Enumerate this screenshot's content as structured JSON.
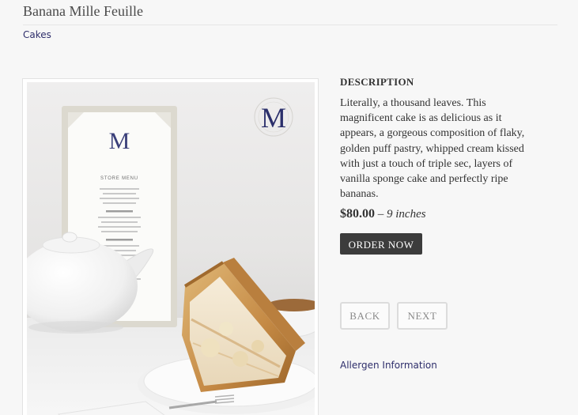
{
  "product": {
    "title": "Banana Mille Feuille",
    "category": "Cakes",
    "description_heading": "DESCRIPTION",
    "description": "Literally, a thousand leaves. This magnificent cake is as delicious as it appears, a gorgeous composition of flaky, golden puff pastry, whipped cream kissed with just a touch of triple sec, layers of vanilla sponge cake and perfectly ripe bananas.",
    "price": "$80.00",
    "size_separator": "–",
    "size": "9 inches"
  },
  "actions": {
    "order_label": "ORDER NOW",
    "back_label": "BACK",
    "next_label": "NEXT",
    "allergen_label": "Allergen Information"
  },
  "photo": {
    "logo_letter": "M",
    "menu_heading": "STORE MENU",
    "icons": {
      "menu_card": "menu-card-icon",
      "teapot": "teapot-icon",
      "cake_slice": "cake-slice-icon"
    }
  },
  "colors": {
    "background": "#f7f7f7",
    "link": "#2e2e6b",
    "button_dark": "#3c3c3c",
    "brand_navy": "#2b2f6b"
  }
}
